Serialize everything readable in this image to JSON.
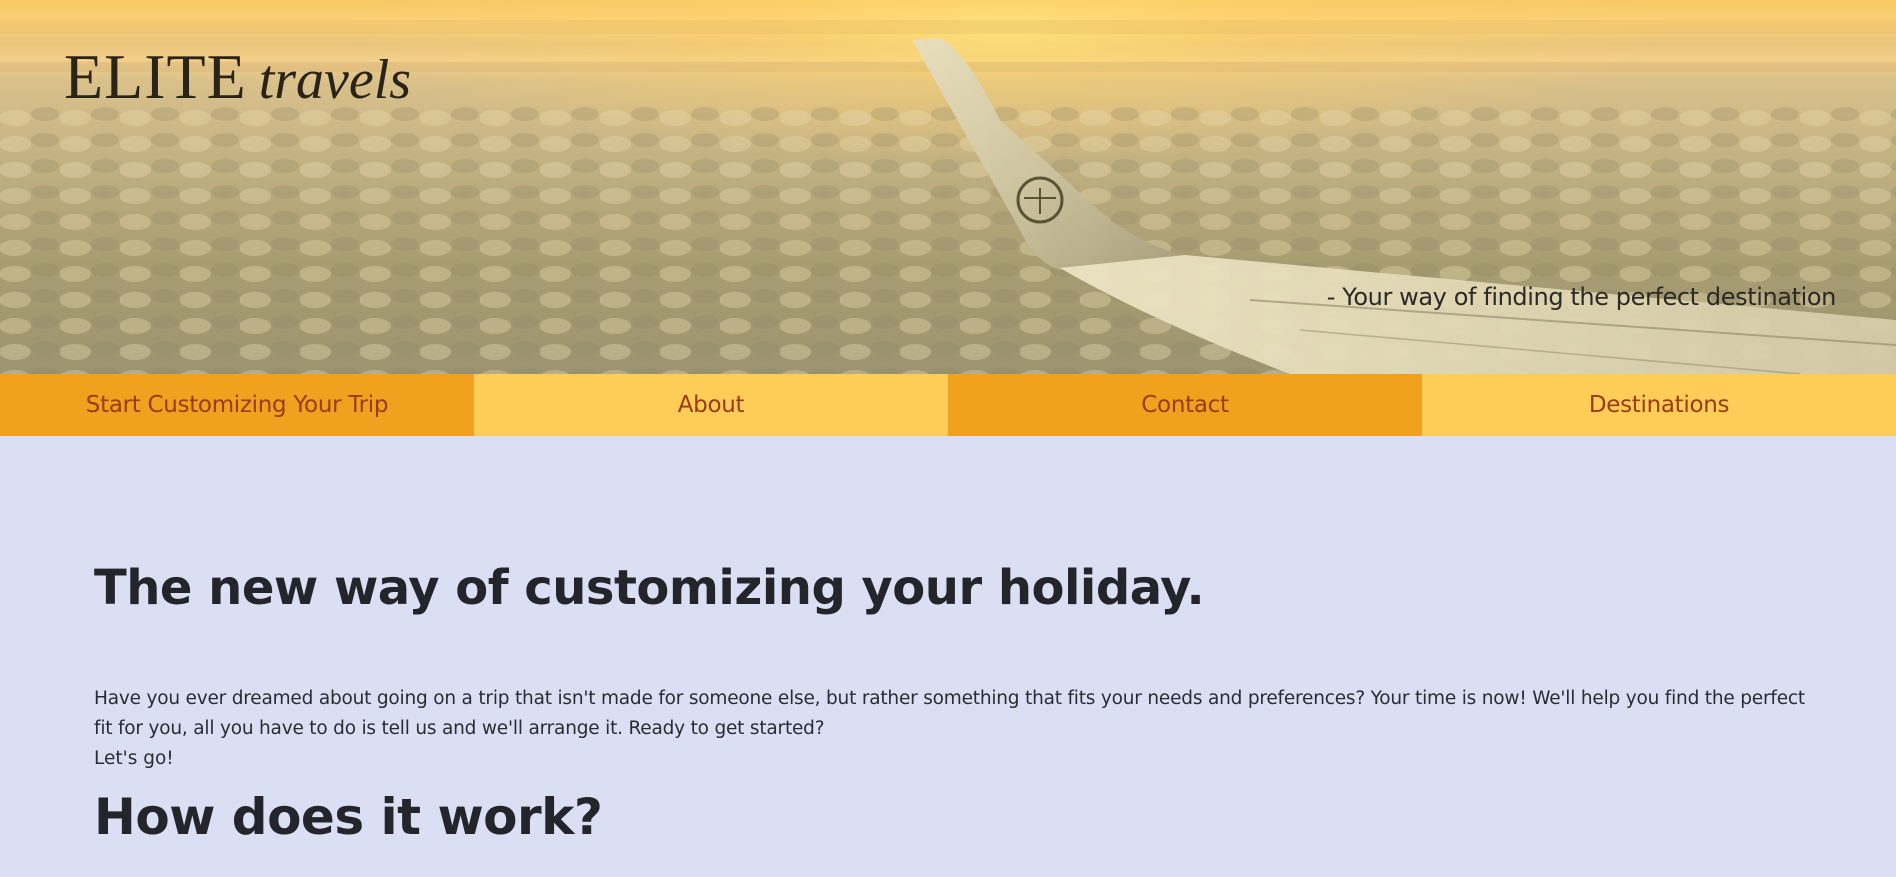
{
  "hero": {
    "brand_main": "ELITE",
    "brand_sub": "travels",
    "tagline": "- Your way of finding the perfect destination"
  },
  "nav": {
    "items": [
      {
        "label": "Start Customizing Your Trip"
      },
      {
        "label": "About"
      },
      {
        "label": "Contact"
      },
      {
        "label": "Destinations"
      }
    ]
  },
  "main": {
    "heading": "The new way of customizing your holiday.",
    "intro": "Have you ever dreamed about going on a trip that isn't made for someone else, but rather something that fits your needs and preferences? Your time is now! We'll help you find the perfect fit for you, all you have to do is tell us and we'll arrange it. Ready to get started?",
    "cta_text": "Let's go!",
    "subheading": "How does it work?"
  },
  "colors": {
    "nav_dark": "#f2a11e",
    "nav_light": "#fecd57",
    "nav_text": "#9a3b12",
    "page_background": "#dbdff4"
  }
}
